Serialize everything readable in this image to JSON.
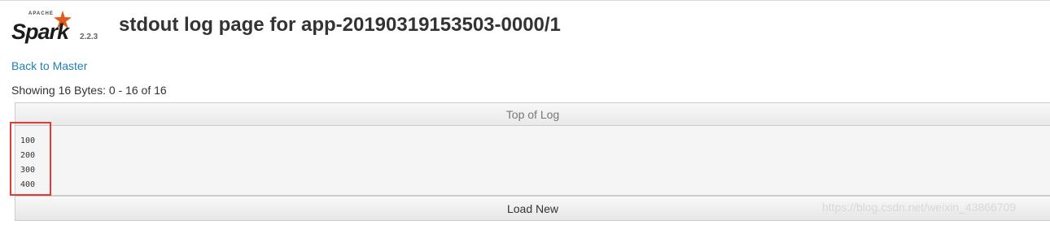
{
  "header": {
    "brand_apache": "APACHE",
    "brand_name": "Spark",
    "version": "2.2.3",
    "title": "stdout log page for app-20190319153503-0000/1"
  },
  "nav": {
    "back_link": "Back to Master"
  },
  "log": {
    "showing_text": "Showing 16 Bytes: 0 - 16 of 16",
    "top_button": "Top of Log",
    "lines": [
      "100",
      "200",
      "300",
      "400"
    ],
    "load_new_button": "Load New"
  },
  "watermark": "https://blog.csdn.net/weixin_43866709",
  "colors": {
    "link": "#1f7fb3",
    "highlight": "#e03a3a",
    "spark_orange": "#e25a1c"
  }
}
